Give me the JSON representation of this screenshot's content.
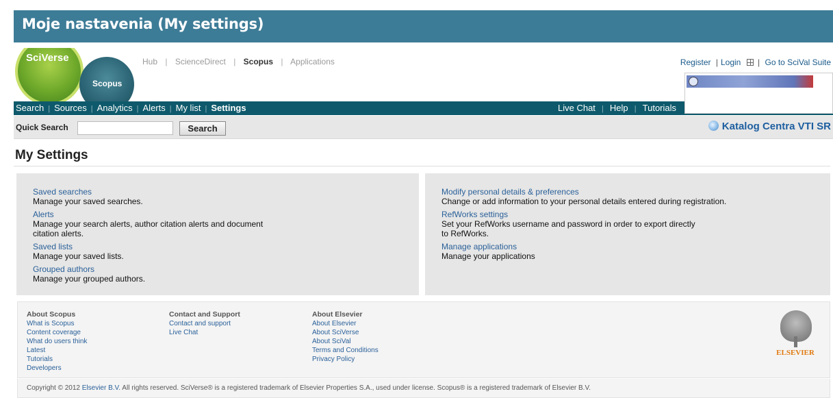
{
  "banner": {
    "title": "Moje nastavenia (My settings)"
  },
  "logos": {
    "sciverse": "SciVerse",
    "scopus": "Scopus"
  },
  "hub_nav": {
    "items": [
      "Hub",
      "ScienceDirect",
      "Scopus",
      "Applications"
    ],
    "active": "Scopus"
  },
  "top_right": {
    "register": "Register",
    "login": "Login",
    "scival": "Go to SciVal Suite"
  },
  "main_nav": {
    "items": [
      "Search",
      "Sources",
      "Analytics",
      "Alerts",
      "My list",
      "Settings"
    ],
    "active": "Settings",
    "right_items": [
      "Live Chat",
      "Help",
      "Tutorials"
    ]
  },
  "quick_search": {
    "label": "Quick Search",
    "value": "",
    "button": "Search",
    "catalog_link": "Katalog Centra VTI SR"
  },
  "page": {
    "title": "My Settings"
  },
  "settings_left": [
    {
      "link": "Saved searches",
      "desc": "Manage your saved searches."
    },
    {
      "link": "Alerts",
      "desc": "Manage your search alerts, author citation alerts and document",
      "desc2": "citation alerts."
    },
    {
      "link": "Saved lists",
      "desc": "Manage your saved lists."
    },
    {
      "link": "Grouped authors",
      "desc": "Manage your grouped authors."
    }
  ],
  "settings_right": [
    {
      "link": "Modify personal details & preferences",
      "desc": "Change or add information to your personal details entered during registration."
    },
    {
      "link": "RefWorks settings",
      "desc": "Set your RefWorks username and password in order to export directly",
      "desc2": "to RefWorks."
    },
    {
      "link": "Manage applications",
      "desc": "Manage your applications"
    }
  ],
  "footer": {
    "columns": [
      {
        "heading": "About Scopus",
        "links": [
          "What is Scopus",
          "Content coverage",
          "What do users think",
          "Latest",
          "Tutorials",
          "Developers"
        ]
      },
      {
        "heading": "Contact and Support",
        "links": [
          "Contact and support",
          "Live Chat"
        ]
      },
      {
        "heading": "About Elsevier",
        "links": [
          "About Elsevier",
          "About SciVerse",
          "About SciVal",
          "Terms and Conditions",
          "Privacy Policy"
        ]
      }
    ],
    "elsevier_logo": "ELSEVIER"
  },
  "copyright": {
    "prefix": "Copyright © 2012 ",
    "link": "Elsevier B.V.",
    "suffix": " All rights reserved. SciVerse® is a registered trademark of Elsevier Properties S.A., used under license. Scopus® is a registered trademark of Elsevier B.V."
  }
}
